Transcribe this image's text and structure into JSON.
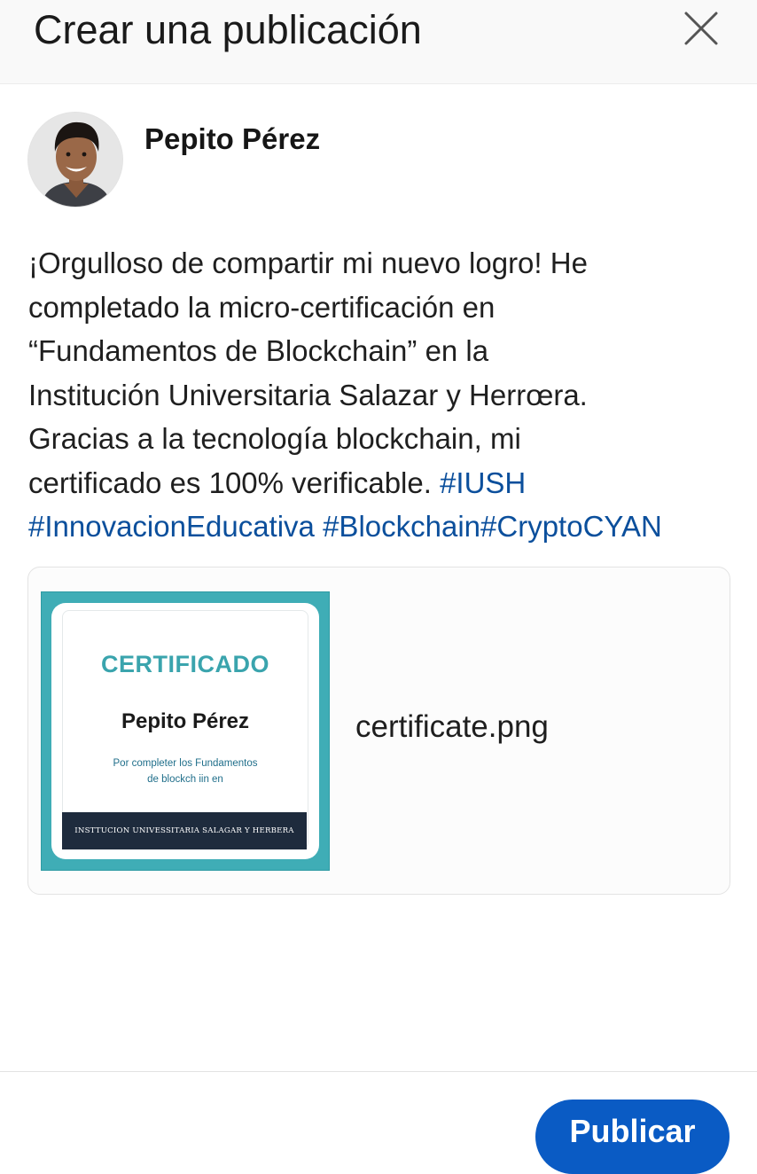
{
  "header": {
    "title": "Crear una publicación"
  },
  "icons": {
    "close": "close-icon",
    "avatar": "user-avatar"
  },
  "author": {
    "name": "Pepito Pérez"
  },
  "post": {
    "lines": [
      "¡Orgulloso de compartir mi nuevo logro!  He",
      "completado la micro-certificación en",
      "“Fundamentos de Blockchain” en la",
      "Institución Universitaria Salazar y Herrœra.",
      "Gracias a la tecnología blockchain, mi"
    ],
    "line6_text": "certificado es 100% verificable. ",
    "hashtag_iush": "#IUSH",
    "hashtag_innovacion": "#InnovacionEducativa",
    "hashtag_blockchain": "#Blockchain",
    "hashtag_crypto": "#CryptoCYAN"
  },
  "attachment": {
    "filename": "certificate.png",
    "certificate": {
      "heading": "CERTIFICADO",
      "name": "Pepito Pérez",
      "desc_line1": "Por completer los Fundamentos",
      "desc_line2": "de blockch iin en",
      "footer": "INSTTUCION UNIVESSITARIA SALAGAR Y HERBERA"
    }
  },
  "footer": {
    "publish_label": "Publicar"
  },
  "colors": {
    "hashtag": "#0b4f9c",
    "primary_button": "#0a5bc4",
    "certificate_teal": "#3fadb6",
    "certificate_footer": "#1e2b3d"
  }
}
